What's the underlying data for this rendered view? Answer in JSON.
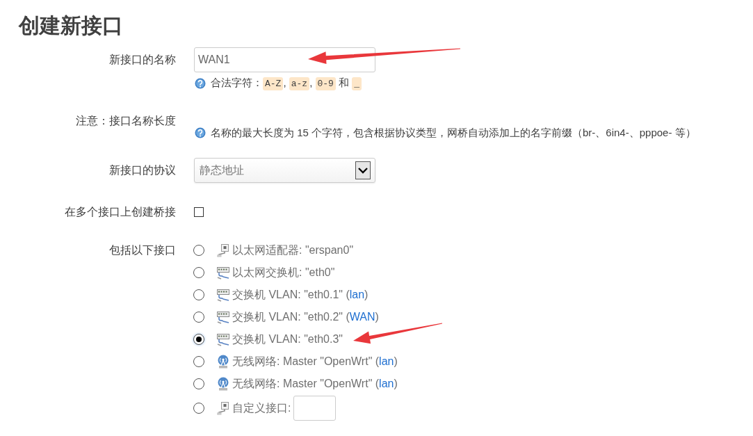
{
  "title": "创建新接口",
  "fields": [
    {
      "kind": "text",
      "label": "新接口的名称",
      "value": "WAN1",
      "arrow": true,
      "hint": [
        {
          "kind": "text",
          "text": "合法字符："
        },
        {
          "kind": "code",
          "text": "A-Z"
        },
        {
          "kind": "text",
          "text": ", "
        },
        {
          "kind": "code",
          "text": "a-z"
        },
        {
          "kind": "text",
          "text": ", "
        },
        {
          "kind": "code",
          "text": "0-9"
        },
        {
          "kind": "text",
          "text": " 和 "
        },
        {
          "kind": "code",
          "text": "_"
        }
      ]
    },
    {
      "kind": "note",
      "label": "注意：接口名称长度",
      "hint": [
        {
          "kind": "text",
          "text": "名称的最大长度为 15 个字符，包含根据协议类型，网桥自动添加上的名字前缀（br-、6in4-、pppoe- 等）"
        }
      ]
    },
    {
      "kind": "select",
      "label": "新接口的协议",
      "value": "静态地址"
    },
    {
      "kind": "checkbox",
      "label": "在多个接口上创建桥接",
      "checked": false
    },
    {
      "kind": "radios",
      "label": "包括以下接口",
      "options": [
        {
          "kind": "adapter",
          "selected": false,
          "arrow": false,
          "parts": [
            {
              "kind": "text",
              "text": "以太网适配器: \"erspan0\""
            }
          ]
        },
        {
          "kind": "switch",
          "selected": false,
          "arrow": false,
          "parts": [
            {
              "kind": "text",
              "text": "以太网交换机: \"eth0\""
            }
          ]
        },
        {
          "kind": "switch",
          "selected": false,
          "arrow": false,
          "parts": [
            {
              "kind": "text",
              "text": "交换机 VLAN: \"eth0.1\" ("
            },
            {
              "kind": "link",
              "text": "lan"
            },
            {
              "kind": "text",
              "text": ")"
            }
          ]
        },
        {
          "kind": "switch",
          "selected": false,
          "arrow": false,
          "parts": [
            {
              "kind": "text",
              "text": "交换机 VLAN: \"eth0.2\" ("
            },
            {
              "kind": "link",
              "text": "WAN"
            },
            {
              "kind": "text",
              "text": ")"
            }
          ]
        },
        {
          "kind": "switch",
          "selected": true,
          "arrow": true,
          "parts": [
            {
              "kind": "text",
              "text": "交换机 VLAN: \"eth0.3\""
            }
          ]
        },
        {
          "kind": "wireless",
          "selected": false,
          "arrow": false,
          "parts": [
            {
              "kind": "text",
              "text": "无线网络: Master \"OpenWrt\" ("
            },
            {
              "kind": "link",
              "text": "lan"
            },
            {
              "kind": "text",
              "text": ")"
            }
          ]
        },
        {
          "kind": "wireless",
          "selected": false,
          "arrow": false,
          "parts": [
            {
              "kind": "text",
              "text": "无线网络: Master \"OpenWrt\" ("
            },
            {
              "kind": "link",
              "text": "lan"
            },
            {
              "kind": "text",
              "text": ")"
            }
          ]
        },
        {
          "kind": "custom",
          "selected": false,
          "arrow": false,
          "parts": [
            {
              "kind": "text",
              "text": "自定义接口:"
            }
          ]
        }
      ]
    }
  ]
}
